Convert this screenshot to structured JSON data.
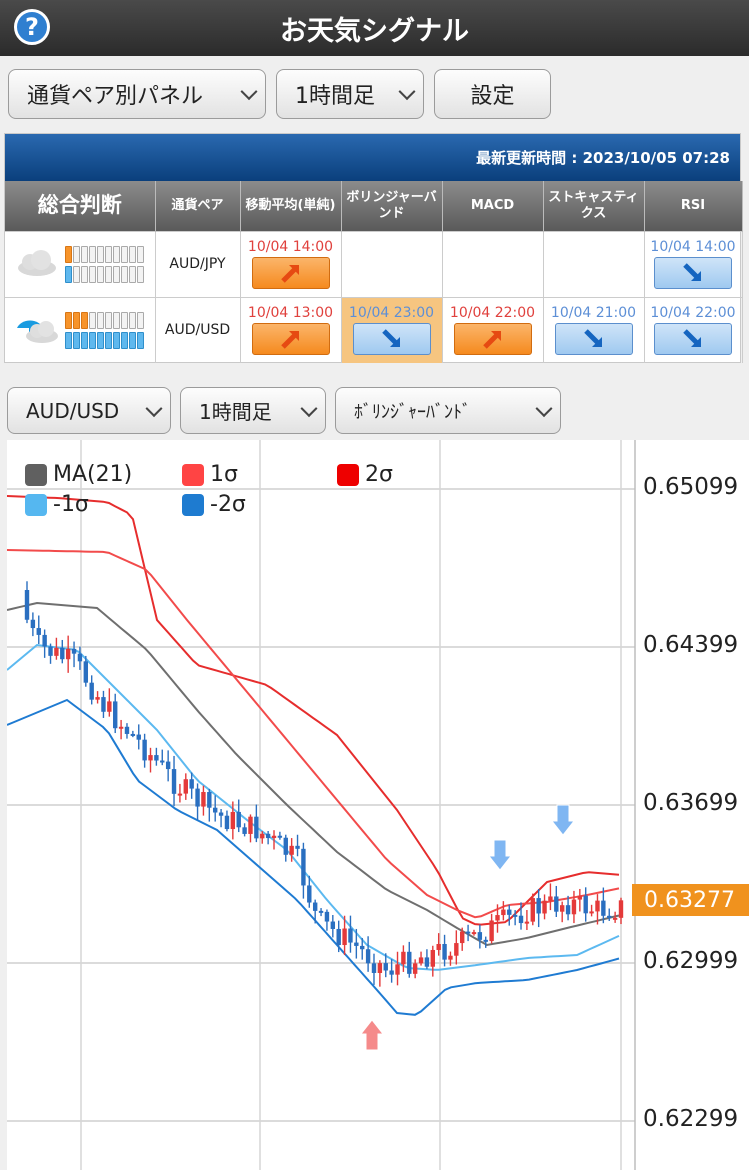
{
  "header": {
    "help_icon": "?",
    "title": "お天気シグナル"
  },
  "toolbar": {
    "panel_select": "通貨ペア別パネル",
    "timeframe_select": "1時間足",
    "settings_button": "設定"
  },
  "panel": {
    "updated": "最新更新時間 : 2023/10/05 07:28",
    "columns": [
      "総合判断",
      "通貨ペア",
      "移動平均(単純)",
      "ボリンジャーバンド",
      "MACD",
      "ストキャスティクス",
      "RSI"
    ],
    "rows": [
      {
        "pair": "AUD/JPY",
        "weather": "cloudy-icon",
        "sma": {
          "time": "10/04 14:00",
          "dir": "up"
        },
        "bb": null,
        "macd": null,
        "stoch": null,
        "rsi": {
          "time": "10/04 14:00",
          "dir": "down"
        }
      },
      {
        "pair": "AUD/USD",
        "weather": "rain-cloud-icon",
        "sma": {
          "time": "10/04 13:00",
          "dir": "up"
        },
        "bb": {
          "time": "10/04 23:00",
          "dir": "down"
        },
        "macd": {
          "time": "10/04 22:00",
          "dir": "up"
        },
        "stoch": {
          "time": "10/04 21:00",
          "dir": "down"
        },
        "rsi": {
          "time": "10/04 22:00",
          "dir": "down"
        }
      }
    ]
  },
  "chart_controls": {
    "pair_select": "AUD/USD",
    "timeframe_select": "1時間足",
    "indicator_select": "ﾎﾞﾘﾝｼﾞｬｰﾊﾞﾝﾄﾞ"
  },
  "chart_data": {
    "type": "line",
    "legend": [
      {
        "name": "MA(21)",
        "color": "#606060"
      },
      {
        "name": "1σ",
        "color": "#ff4444"
      },
      {
        "name": "2σ",
        "color": "#ee0000"
      },
      {
        "name": "-1σ",
        "color": "#55b7f0"
      },
      {
        "name": "-2σ",
        "color": "#1e7bd0"
      }
    ],
    "y_ticks": [
      "0.65099",
      "0.64399",
      "0.63699",
      "0.62999",
      "0.62299"
    ],
    "ylim": [
      0.62299,
      0.65099
    ],
    "current_price": "0.63277",
    "colors": {
      "up": "#e43a3a",
      "down": "#2a6fc0",
      "current": "#f0921e"
    }
  }
}
